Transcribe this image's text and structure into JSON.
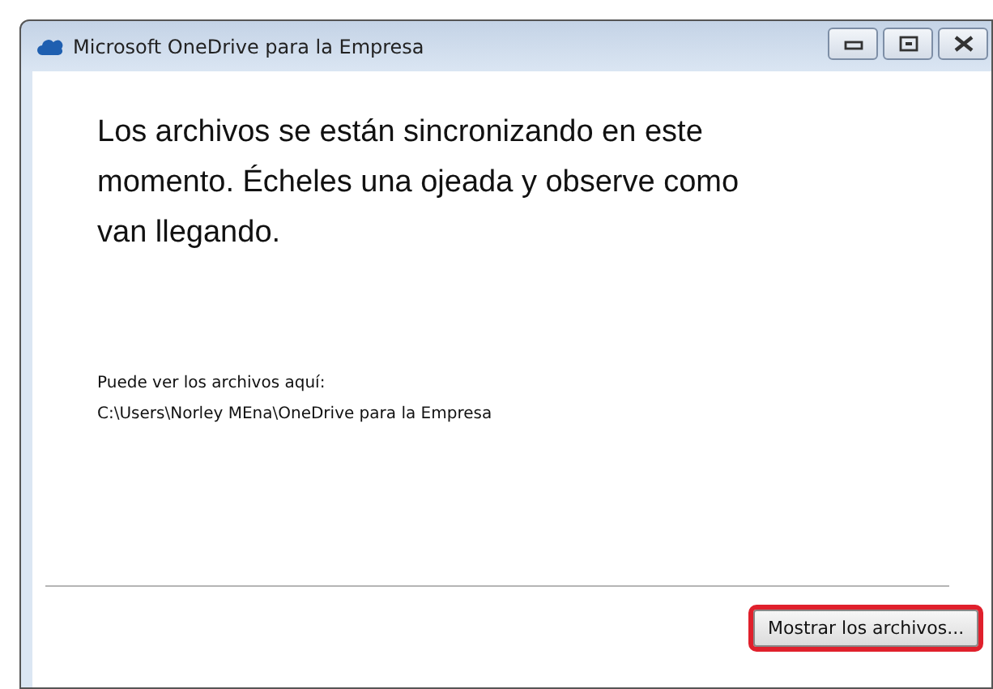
{
  "window": {
    "title": "Microsoft OneDrive para la Empresa"
  },
  "message": "Los archivos se están sincronizando en este momento. Écheles una ojeada y observe como van llegando.",
  "location": {
    "label": "Puede ver los archivos aquí:",
    "path": "C:\\Users\\Norley MEna\\OneDrive para la Empresa"
  },
  "buttons": [
    {
      "label": "Mostrar los archivos...",
      "highlighted": true
    }
  ]
}
